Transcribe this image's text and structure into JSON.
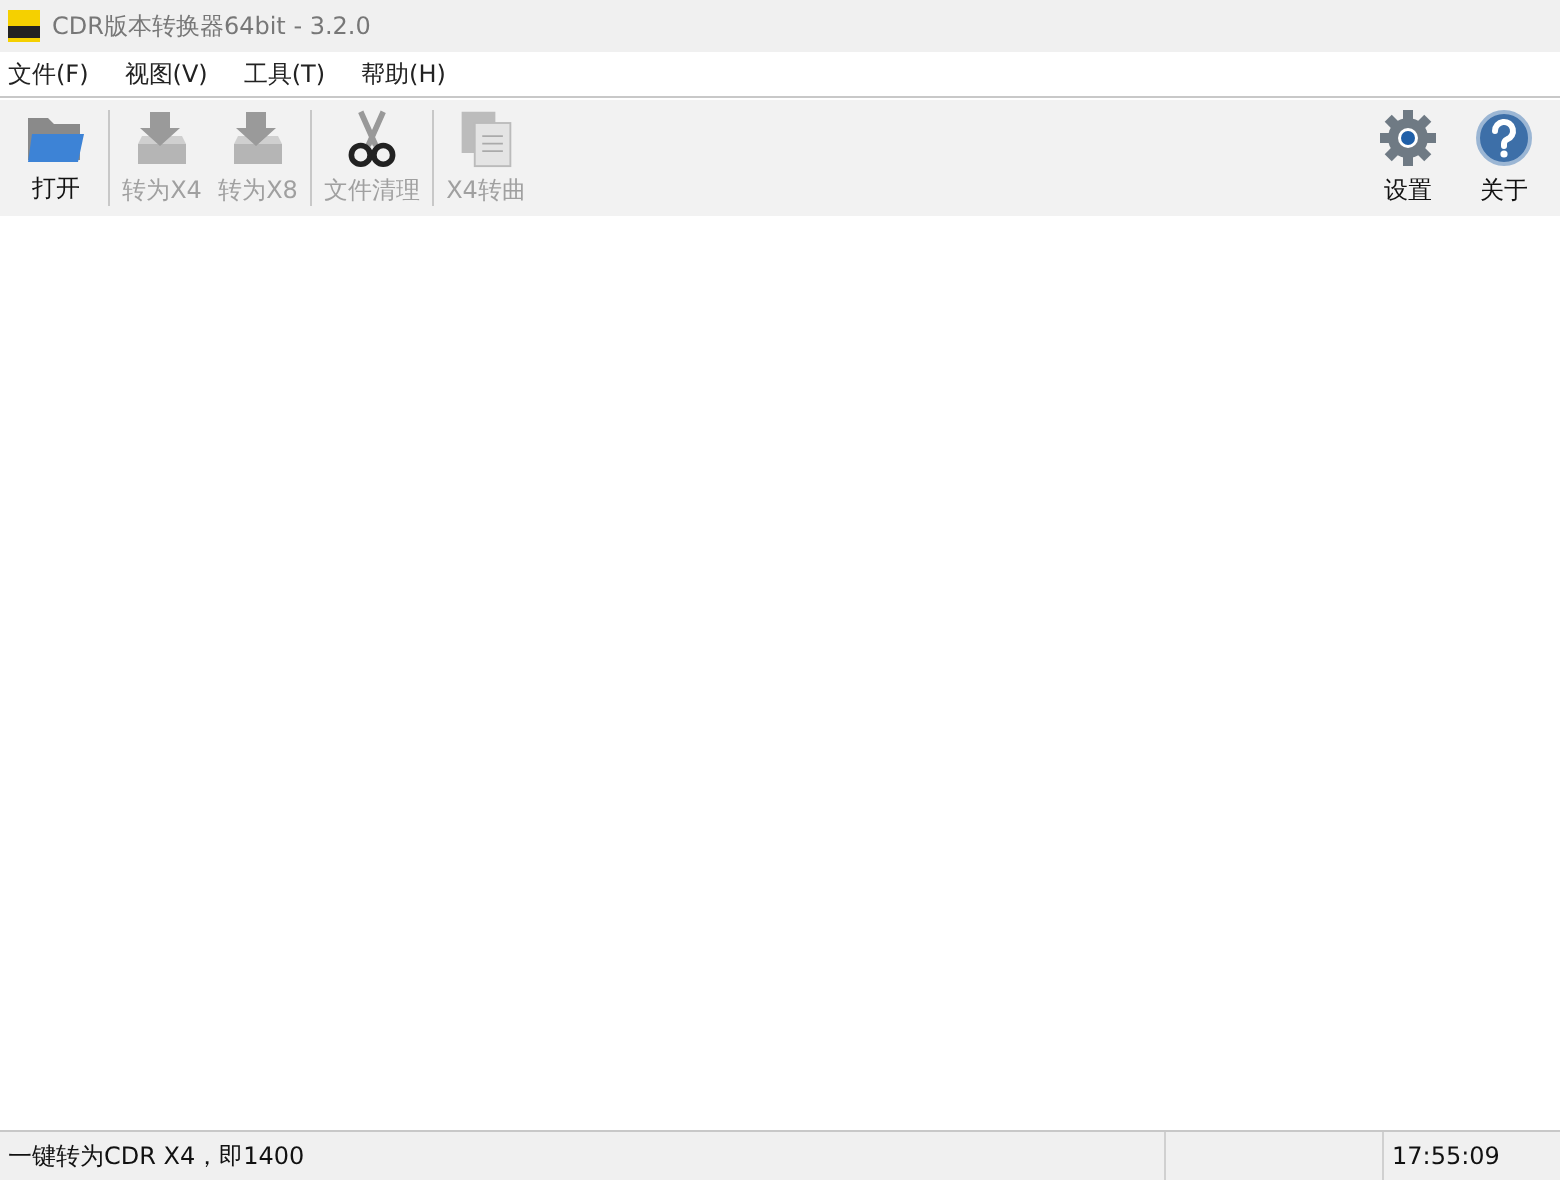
{
  "window": {
    "title": "CDR版本转换器64bit - 3.2.0"
  },
  "menu": [
    "文件(F)",
    "视图(V)",
    "工具(T)",
    "帮助(H)"
  ],
  "toolbar": {
    "left_groups": [
      [
        {
          "kind": "open",
          "label": "打开",
          "disabled": false
        }
      ],
      [
        {
          "kind": "convert",
          "label": "转为X4",
          "disabled": true
        },
        {
          "kind": "convert",
          "label": "转为X8",
          "disabled": true
        }
      ],
      [
        {
          "kind": "clean",
          "label": "文件清理",
          "disabled": true
        }
      ],
      [
        {
          "kind": "curves",
          "label": "X4转曲",
          "disabled": true
        }
      ]
    ],
    "right": [
      {
        "kind": "settings",
        "label": "设置",
        "disabled": false
      },
      {
        "kind": "about",
        "label": "关于",
        "disabled": false
      }
    ]
  },
  "status_bar": {
    "message": "一键转为CDR X4，即1400",
    "time": "17:55:09"
  }
}
